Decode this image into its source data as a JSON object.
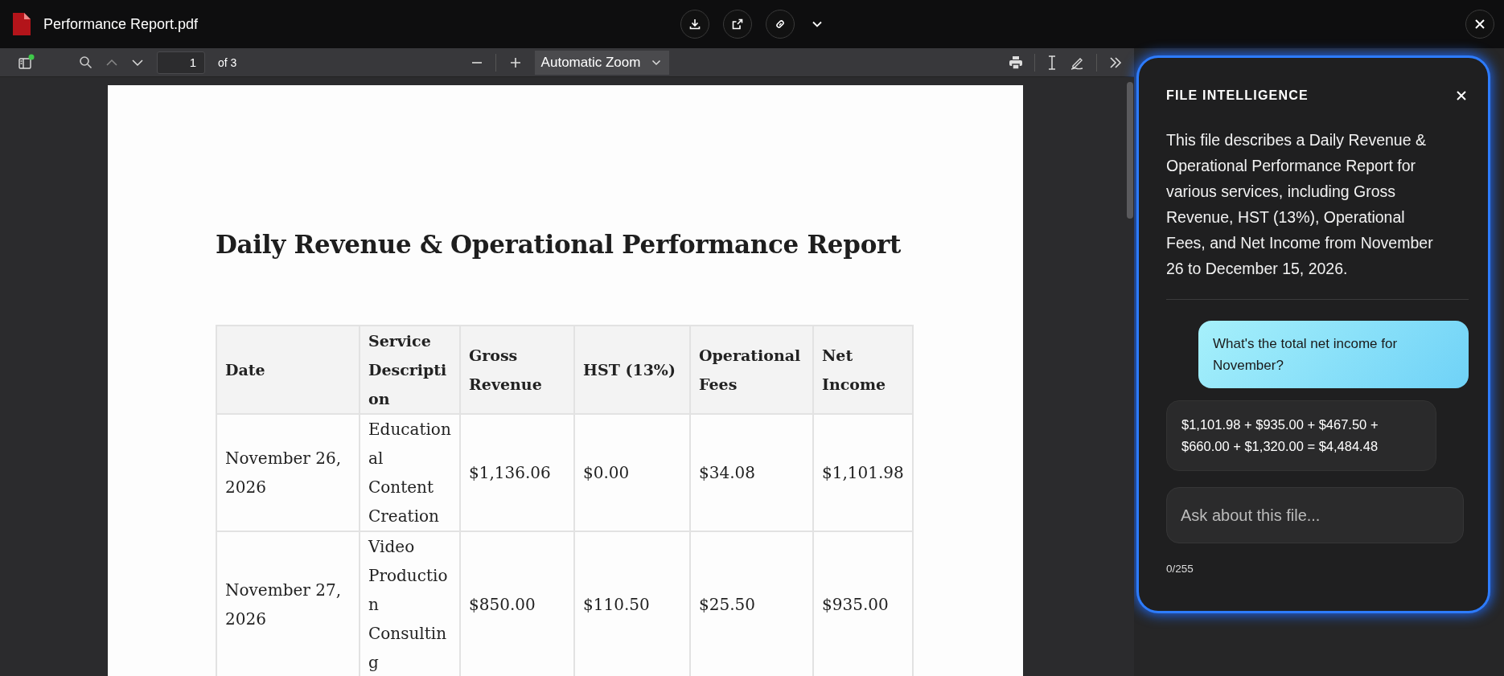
{
  "window": {
    "title": "Performance Report.pdf"
  },
  "toolbar": {
    "page_number": "1",
    "page_total": "of 3",
    "zoom": "Automatic Zoom"
  },
  "document": {
    "heading": "Daily Revenue & Operational Performance Report",
    "columns": [
      "Date",
      "Service Description",
      "Gross Revenue",
      "HST (13%)",
      "Operational Fees",
      "Net Income"
    ],
    "rows": [
      {
        "cells": [
          "November 26, 2026",
          "Educational Content Creation",
          "$1,136.06",
          "$0.00",
          "$34.08",
          "$1,101.98"
        ]
      },
      {
        "cells": [
          "November 27, 2026",
          "Video Production Consulting",
          "$850.00",
          "$110.50",
          "$25.50",
          "$935.00"
        ]
      }
    ]
  },
  "panel": {
    "title": "FILE INTELLIGENCE",
    "summary": "This file describes a Daily Revenue & Operational Performance Report for various services, including Gross Revenue, HST (13%), Operational Fees, and Net Income from November 26 to December 15, 2026.",
    "messages": [
      {
        "kind": "user",
        "text": "What's the total net income for November?"
      },
      {
        "kind": "assistant",
        "text": "$1,101.98 + $935.00 + $467.50 + $660.00 + $1,320.00 = $4,484.48"
      }
    ],
    "input": {
      "placeholder": "Ask about this file..."
    },
    "counter": "0/255"
  }
}
